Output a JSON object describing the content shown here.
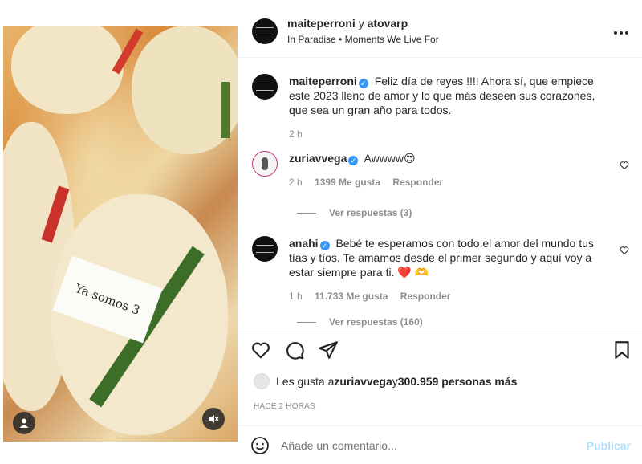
{
  "post": {
    "header": {
      "user1": "maiteperroni",
      "joiner": " y ",
      "user2": "atovarp",
      "location": "In Paradise • Moments We Live For",
      "more_icon": "more-horizontal-icon"
    },
    "media_text": "Ya somos 3",
    "caption": {
      "user": "maiteperroni",
      "text": "Feliz día de reyes !!!! Ahora sí, que empiece este 2023 lleno de amor y lo que más deseen sus corazones, que sea un gran año para todos.",
      "time": "2 h"
    },
    "comments": [
      {
        "user": "zuriavvega",
        "text": "Awwww😍",
        "time": "2 h",
        "likes": "1399 Me gusta",
        "reply": "Responder",
        "view_replies": "Ver respuestas (3)"
      },
      {
        "user": "anahi",
        "text": "Bebé te esperamos con todo el amor del mundo tus tías y tíos. Te amamos desde el primer segundo y aquí voy a estar siempre para ti. ❤️ 🫶",
        "time": "1 h",
        "likes": "11.733 Me gusta",
        "reply": "Responder",
        "view_replies": "Ver respuestas (160)"
      }
    ],
    "likes_line": {
      "prefix": "Les gusta a ",
      "user": "zuriavvega",
      "middle": " y ",
      "count": "300.959 personas más"
    },
    "time_ago": "HACE 2 HORAS",
    "add_comment": {
      "placeholder": "Añade un comentario...",
      "publish_label": "Publicar"
    }
  },
  "colors": {
    "verified": "#3897f0",
    "publish_disabled": "#b2dffc",
    "heart_red": "#ed4956"
  }
}
